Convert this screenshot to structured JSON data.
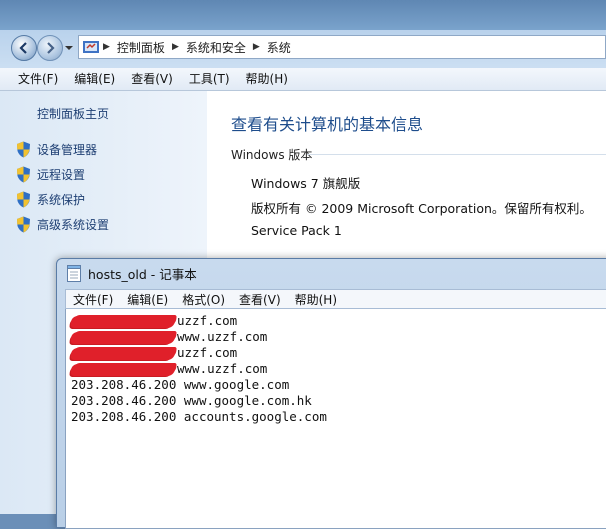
{
  "explorer": {
    "breadcrumb": [
      "控制面板",
      "系统和安全",
      "系统"
    ],
    "menu": [
      "文件(F)",
      "编辑(E)",
      "查看(V)",
      "工具(T)",
      "帮助(H)"
    ],
    "left_pane": {
      "home": "控制面板主页",
      "items": [
        "设备管理器",
        "远程设置",
        "系统保护",
        "高级系统设置"
      ]
    },
    "main": {
      "title": "查看有关计算机的基本信息",
      "section": "Windows 版本",
      "edition": "Windows 7 旗舰版",
      "copyright": "版权所有 © 2009 Microsoft Corporation。保留所有权利。",
      "service_pack": "Service Pack 1"
    }
  },
  "notepad": {
    "title": "hosts_old - 记事本",
    "menu": [
      "文件(F)",
      "编辑(E)",
      "格式(O)",
      "查看(V)",
      "帮助(H)"
    ],
    "lines": [
      {
        "redacted": true,
        "host": "uzzf.com"
      },
      {
        "redacted": true,
        "host": "www.uzzf.com"
      },
      {
        "redacted": true,
        "host": "uzzf.com"
      },
      {
        "redacted": true,
        "host": "www.uzzf.com"
      },
      {
        "redacted": false,
        "ip": "203.208.46.200",
        "host": "www.google.com"
      },
      {
        "redacted": false,
        "ip": "203.208.46.200",
        "host": "www.google.com.hk"
      },
      {
        "redacted": false,
        "ip": "203.208.46.200",
        "host": "accounts.google.com"
      }
    ],
    "caret_line": 6
  },
  "colors": {
    "link": "#1e3f73",
    "title_blue": "#1e4d8c",
    "redaction": "#e0202a",
    "shield_blue": "#2f6fc4",
    "shield_yellow": "#f2c230"
  },
  "icons": {
    "nav_back": "back-arrow-icon",
    "nav_forward": "forward-arrow-icon",
    "address": "control-panel-icon",
    "shield": "uac-shield-icon",
    "notepad": "notepad-icon"
  }
}
